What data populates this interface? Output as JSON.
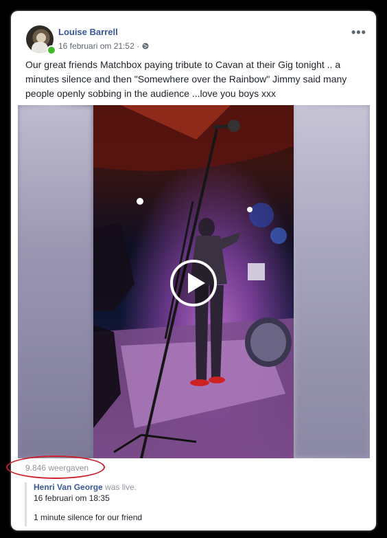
{
  "post": {
    "author": "Louise Barrell",
    "timestamp": "16 februari om 21:52 ·",
    "visibility_icon": "globe-icon",
    "more_icon": "more-options-icon",
    "text": "Our great friends Matchbox paying tribute to Cavan at their Gig tonight .. a minutes silence and then \"Somewhere over the Rainbow\" Jimmy said many people openly sobbing in the audience ...love you boys xxx"
  },
  "video": {
    "play_icon": "play-icon",
    "views": "9.846 weergaven"
  },
  "shared": {
    "author": "Henri Van George",
    "status": "was live.",
    "time": "16 februari om 18:35",
    "text": "1 minute silence for our friend"
  },
  "colors": {
    "link": "#385898",
    "online": "#42b72a",
    "highlight": "#cc1f2a"
  }
}
